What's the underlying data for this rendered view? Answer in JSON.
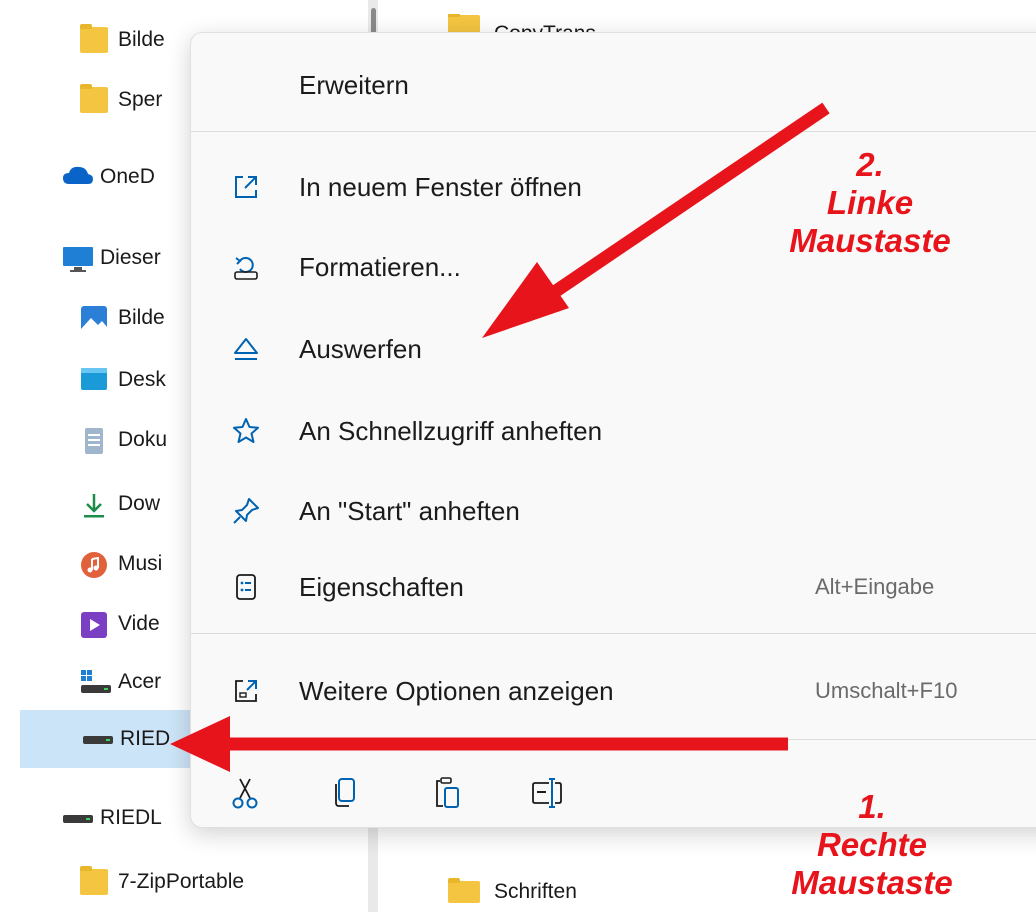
{
  "nav": {
    "items": [
      {
        "label": "Bilde",
        "icon": "folder-icon"
      },
      {
        "label": "Sper",
        "icon": "folder-icon"
      },
      {
        "label": "OneD",
        "icon": "onedrive-cloud-icon"
      },
      {
        "label": "Dieser",
        "icon": "this-pc-monitor-icon"
      },
      {
        "label": "Bilde",
        "icon": "pictures-icon"
      },
      {
        "label": "Desk",
        "icon": "desktop-icon"
      },
      {
        "label": "Doku",
        "icon": "documents-icon"
      },
      {
        "label": "Dow",
        "icon": "downloads-icon"
      },
      {
        "label": "Musi",
        "icon": "music-icon"
      },
      {
        "label": "Vide",
        "icon": "videos-icon"
      },
      {
        "label": "Acer",
        "icon": "system-drive-icon"
      },
      {
        "label": "RIED",
        "icon": "drive-icon"
      },
      {
        "label": "RIEDL",
        "icon": "drive-icon"
      },
      {
        "label": "7-ZipPortable",
        "icon": "folder-icon"
      }
    ]
  },
  "content": {
    "top_item": "CopyTrans",
    "bottom_item": "Schriften"
  },
  "menu": {
    "expand": "Erweitern",
    "open_new_window": "In neuem Fenster öffnen",
    "format": "Formatieren...",
    "eject": "Auswerfen",
    "pin_quick_access": "An Schnellzugriff anheften",
    "pin_start": "An \"Start\" anheften",
    "properties": "Eigenschaften",
    "properties_shortcut": "Alt+Eingabe",
    "more_options": "Weitere Optionen anzeigen",
    "more_options_shortcut": "Umschalt+F10",
    "quick_actions": [
      "scissors-icon",
      "copy-icon",
      "paste-icon",
      "rename-icon"
    ]
  },
  "annotations": {
    "step2": [
      "2.",
      "Linke",
      "Maustaste"
    ],
    "step1": [
      "1.",
      "Rechte",
      "Maustaste"
    ]
  },
  "colors": {
    "annotation_red": "#e8141c",
    "selection_blue": "#cce4f7",
    "accent_blue": "#0063b1"
  }
}
